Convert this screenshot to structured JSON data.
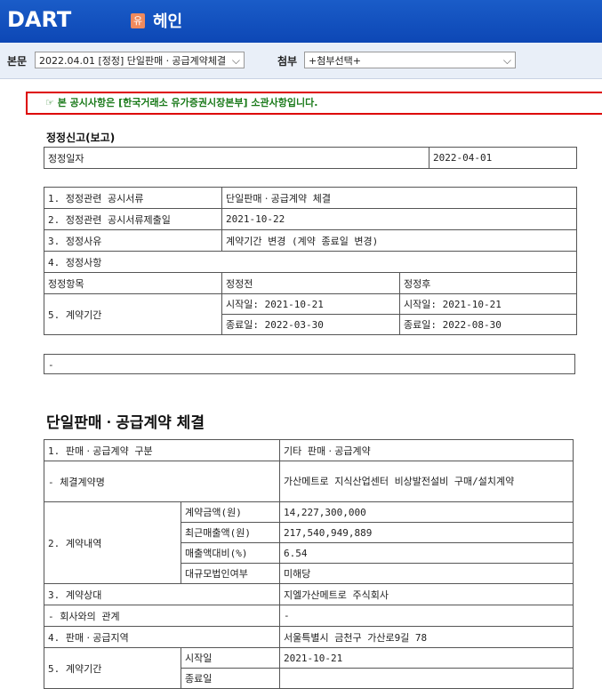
{
  "header": {
    "logo": "DART",
    "badge": "유",
    "company": "헤인"
  },
  "toolbar": {
    "main_label": "본문",
    "main_value": "2022.04.01  [정정] 단일판매ㆍ공급계약체결",
    "attach_label": "첨부",
    "attach_value": "+첨부선택+"
  },
  "notice": {
    "icon": "☞",
    "text": "본 공시사항은 [한국거래소 유가증권시장본부] 소관사항입니다."
  },
  "correction": {
    "title": "정정신고(보고)",
    "date_label": "정정일자",
    "date_value": "2022-04-01",
    "rows": [
      {
        "label": "1. 정정관련 공시서류",
        "value": "단일판매ㆍ공급계약 체결"
      },
      {
        "label": "2. 정정관련 공시서류제출일",
        "value": "2021-10-22"
      },
      {
        "label": "3. 정정사유",
        "value": "계약기간 변경 (계약 종료일 변경)"
      },
      {
        "label": "4. 정정사항",
        "value": ""
      }
    ],
    "header_item": "정정항목",
    "header_before": "정정전",
    "header_after": "정정후",
    "item_label": "5. 계약기간",
    "before_start": "시작일: 2021-10-21",
    "before_end": "종료일: 2022-03-30",
    "after_start": "시작일: 2021-10-21",
    "after_end": "종료일: 2022-08-30",
    "dash": "-"
  },
  "contract": {
    "title": "단일판매ㆍ공급계약 체결",
    "r1_label": "1. 판매ㆍ공급계약 구분",
    "r1_value": "기타 판매ㆍ공급계약",
    "r2_label": "- 체결계약명",
    "r2_value": "가산메트로 지식산업센터 비상발전설비 구매/설치계약",
    "r3_label": "2. 계약내역",
    "r3_items": [
      {
        "k": "계약금액(원)",
        "v": "14,227,300,000"
      },
      {
        "k": "최근매출액(원)",
        "v": "217,540,949,889"
      },
      {
        "k": "매출액대비(%)",
        "v": "6.54"
      },
      {
        "k": "대규모법인여부",
        "v": "미해당"
      }
    ],
    "r4_label": "3. 계약상대",
    "r4_value": "지엘가산메트로 주식회사",
    "r5_label": "- 회사와의 관계",
    "r5_value": "-",
    "r6_label": "4. 판매ㆍ공급지역",
    "r6_value": "서울특별시 금천구 가산로9길 78",
    "r7_label": "5. 계약기간",
    "r7_sub1": "시작일",
    "r7_val1": "2021-10-21",
    "r7_sub2": "종료일",
    "r7_val2": ""
  }
}
